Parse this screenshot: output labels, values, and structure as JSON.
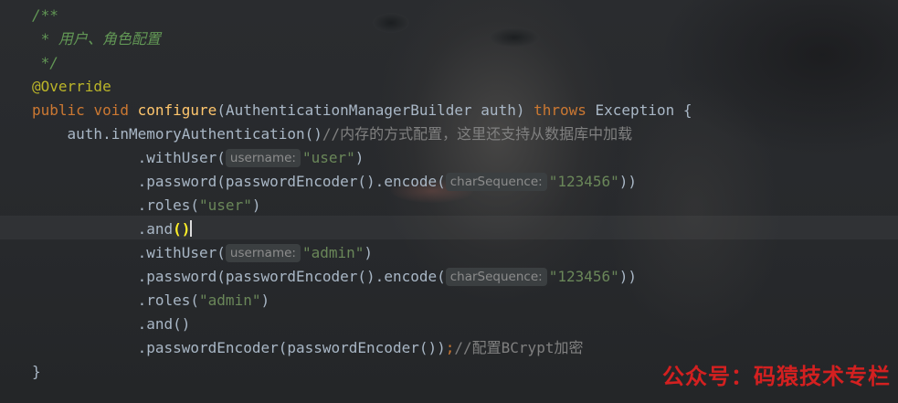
{
  "editor": {
    "lines": [
      {
        "segments": [
          {
            "t": "/**",
            "c": "doc"
          }
        ]
      },
      {
        "segments": [
          {
            "t": " * 用户、角色配置",
            "c": "doc"
          }
        ]
      },
      {
        "segments": [
          {
            "t": " */",
            "c": "doc"
          }
        ]
      },
      {
        "segments": [
          {
            "t": "@Override",
            "c": "ann"
          }
        ]
      },
      {
        "segments": [
          {
            "t": "public",
            "c": "kw"
          },
          {
            "t": " "
          },
          {
            "t": "void",
            "c": "kw"
          },
          {
            "t": " "
          },
          {
            "t": "configure",
            "c": "fn"
          },
          {
            "t": "(AuthenticationManagerBuilder auth) "
          },
          {
            "t": "throws",
            "c": "kw"
          },
          {
            "t": " Exception {"
          }
        ]
      },
      {
        "segments": [
          {
            "t": "    auth.inMemoryAuthentication()"
          },
          {
            "t": "//内存的方式配置，这里还支持从数据库中加载",
            "c": "cmt"
          }
        ]
      },
      {
        "segments": [
          {
            "t": "            .withUser("
          },
          {
            "hint": "username:"
          },
          {
            "t": "\"user\"",
            "c": "str"
          },
          {
            "t": ")"
          }
        ]
      },
      {
        "segments": [
          {
            "t": "            .password(passwordEncoder().encode("
          },
          {
            "hint": "charSequence:"
          },
          {
            "t": "\"123456\"",
            "c": "str"
          },
          {
            "t": "))"
          }
        ]
      },
      {
        "segments": [
          {
            "t": "            .roles("
          },
          {
            "t": "\"user\"",
            "c": "str"
          },
          {
            "t": ")"
          }
        ]
      },
      {
        "segments": [
          {
            "t": "            .and"
          },
          {
            "t": "()",
            "c": "paren-hl"
          },
          {
            "caret": true
          }
        ]
      },
      {
        "segments": [
          {
            "t": "            .withUser("
          },
          {
            "hint": "username:"
          },
          {
            "t": "\"admin\"",
            "c": "str"
          },
          {
            "t": ")"
          }
        ]
      },
      {
        "segments": [
          {
            "t": "            .password(passwordEncoder().encode("
          },
          {
            "hint": "charSequence:"
          },
          {
            "t": "\"123456\"",
            "c": "str"
          },
          {
            "t": "))"
          }
        ]
      },
      {
        "segments": [
          {
            "t": "            .roles("
          },
          {
            "t": "\"admin\"",
            "c": "str"
          },
          {
            "t": ")"
          }
        ]
      },
      {
        "segments": [
          {
            "t": "            .and()"
          }
        ]
      },
      {
        "segments": [
          {
            "t": "            .passwordEncoder(passwordEncoder())"
          },
          {
            "t": ";",
            "c": "kw"
          },
          {
            "t": "//配置BCrypt加密",
            "c": "cmt"
          }
        ]
      },
      {
        "segments": [
          {
            "t": "}"
          }
        ]
      }
    ]
  },
  "watermark": {
    "text": "公众号：码猿技术专栏"
  }
}
